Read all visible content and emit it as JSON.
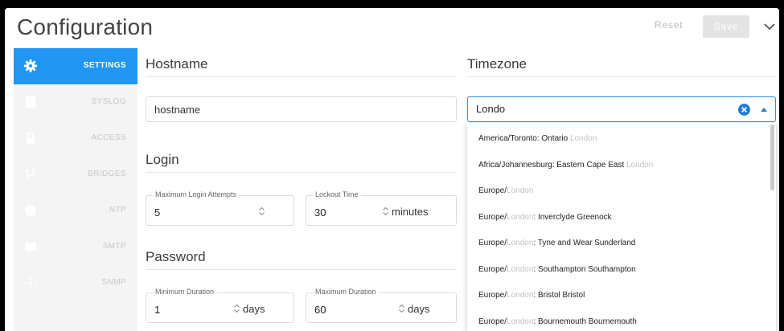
{
  "header": {
    "title": "Configuration",
    "reset_label": "Reset",
    "save_label": "Save"
  },
  "sidebar": {
    "items": [
      {
        "label": "SETTINGS",
        "icon": "gear-icon",
        "active": true
      },
      {
        "label": "SYSLOG",
        "icon": "document-icon",
        "active": false
      },
      {
        "label": "ACCESS",
        "icon": "lock-icon",
        "active": false
      },
      {
        "label": "BRIDGES",
        "icon": "fork-icon",
        "active": false
      },
      {
        "label": "NTP",
        "icon": "clock-icon",
        "active": false
      },
      {
        "label": "SMTP",
        "icon": "mail-icon",
        "active": false
      },
      {
        "label": "SNMP",
        "icon": "network-icon",
        "active": false
      }
    ]
  },
  "hostname": {
    "section_title": "Hostname",
    "value": "hostname"
  },
  "login": {
    "section_title": "Login",
    "max_attempts_label": "Maximum Login Attempts",
    "max_attempts_value": "5",
    "lockout_label": "Lockout Time",
    "lockout_value": "30",
    "lockout_unit": "minutes"
  },
  "password": {
    "section_title": "Password",
    "min_label": "Minimum Duration",
    "min_value": "1",
    "min_unit": "days",
    "max_label": "Maximum Duration",
    "max_value": "60",
    "max_unit": "days"
  },
  "timezone": {
    "section_title": "Timezone",
    "query": "Londo",
    "options": [
      {
        "pre": "America/Toronto: Ontario ",
        "match": "London",
        "post": ""
      },
      {
        "pre": "Africa/Johannesburg: Eastern Cape East ",
        "match": "London",
        "post": ""
      },
      {
        "pre": "Europe/",
        "match": "London",
        "post": ""
      },
      {
        "pre": "Europe/",
        "match": "London",
        "post": ": Inverclyde Greenock"
      },
      {
        "pre": "Europe/",
        "match": "London",
        "post": ": Tyne and Wear Sunderland"
      },
      {
        "pre": "Europe/",
        "match": "London",
        "post": ": Southampton Southampton"
      },
      {
        "pre": "Europe/",
        "match": "London",
        "post": ": Bristol Bristol"
      },
      {
        "pre": "Europe/",
        "match": "London",
        "post": ": Bournemouth Bournemouth"
      }
    ]
  },
  "colors": {
    "accent": "#2196f3",
    "sidebar_bg": "#f4f4f4",
    "match_highlight": "#c3c3c3"
  }
}
